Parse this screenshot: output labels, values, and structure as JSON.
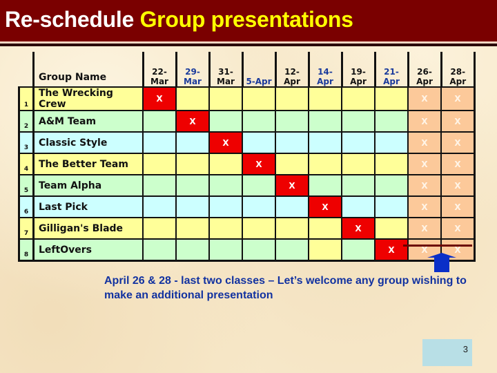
{
  "title": {
    "part1": "Re-schedule ",
    "part2": "Group presentations"
  },
  "colors": {
    "title_bar": "#7a0000",
    "title_white": "#ffffff",
    "title_yellow": "#ffff00",
    "scheduled": "#ee0000",
    "optional": "#fcc99a",
    "row_yellow": "#ffff99",
    "row_green": "#ccffcc",
    "row_cyan": "#ccffff",
    "note_text": "#1232a0",
    "arrow": "#0a2fc8"
  },
  "table": {
    "name_header": "Group Name",
    "columns": [
      {
        "label1": "22-",
        "label2": "Mar",
        "color": "black"
      },
      {
        "label1": "29-",
        "label2": "Mar",
        "color": "blue"
      },
      {
        "label1": "31-",
        "label2": "Mar",
        "color": "black"
      },
      {
        "label1": "",
        "label2": "5-Apr",
        "color": "blue"
      },
      {
        "label1": "12-",
        "label2": "Apr",
        "color": "black"
      },
      {
        "label1": "14-",
        "label2": "Apr",
        "color": "blue"
      },
      {
        "label1": "19-",
        "label2": "Apr",
        "color": "black"
      },
      {
        "label1": "21-",
        "label2": "Apr",
        "color": "blue"
      },
      {
        "label1": "26-",
        "label2": "Apr",
        "color": "black"
      },
      {
        "label1": "28-",
        "label2": "Apr",
        "color": "black"
      }
    ],
    "rows": [
      {
        "num": "1",
        "name": "The Wrecking Crew",
        "bg": "y",
        "cells": [
          "X",
          "",
          "",
          "",
          "",
          "",
          "",
          "",
          "X",
          "X"
        ],
        "scheduled_col": 0
      },
      {
        "num": "2",
        "name": "A&M Team",
        "bg": "g",
        "cells": [
          "",
          "X",
          "",
          "",
          "",
          "",
          "",
          "",
          "X",
          "X"
        ],
        "scheduled_col": 1
      },
      {
        "num": "3",
        "name": "Classic Style",
        "bg": "c",
        "cells": [
          "",
          "",
          "X",
          "",
          "",
          "",
          "",
          "",
          "X",
          "X"
        ],
        "scheduled_col": 2
      },
      {
        "num": "4",
        "name": "The Better Team",
        "bg": "y",
        "cells": [
          "",
          "",
          "",
          "X",
          "",
          "",
          "",
          "",
          "X",
          "X"
        ],
        "scheduled_col": 3
      },
      {
        "num": "5",
        "name": "Team Alpha",
        "bg": "g",
        "cells": [
          "",
          "",
          "",
          "",
          "X",
          "",
          "",
          "",
          "X",
          "X"
        ],
        "scheduled_col": 4
      },
      {
        "num": "6",
        "name": "Last Pick",
        "bg": "c",
        "cells": [
          "",
          "",
          "",
          "",
          "",
          "X",
          "",
          "",
          "X",
          "X"
        ],
        "scheduled_col": 5
      },
      {
        "num": "7",
        "name": "Gilligan's Blade",
        "bg": "y",
        "cells": [
          "",
          "",
          "",
          "",
          "",
          "",
          "X",
          "",
          "X",
          "X"
        ],
        "scheduled_col": 6
      },
      {
        "num": "8",
        "name": "LeftOvers",
        "bg": "g",
        "cells": [
          "",
          "",
          "",
          "",
          "",
          "",
          "",
          "X",
          "X",
          "X"
        ],
        "scheduled_col": 7,
        "override_bg": {
          "5": "y"
        }
      }
    ]
  },
  "note": "April 26 & 28 - last two classes – Let’s welcome any group wishing to make an additional presentation",
  "arrow_icon": "arrow-up-icon",
  "slide_number": "3"
}
